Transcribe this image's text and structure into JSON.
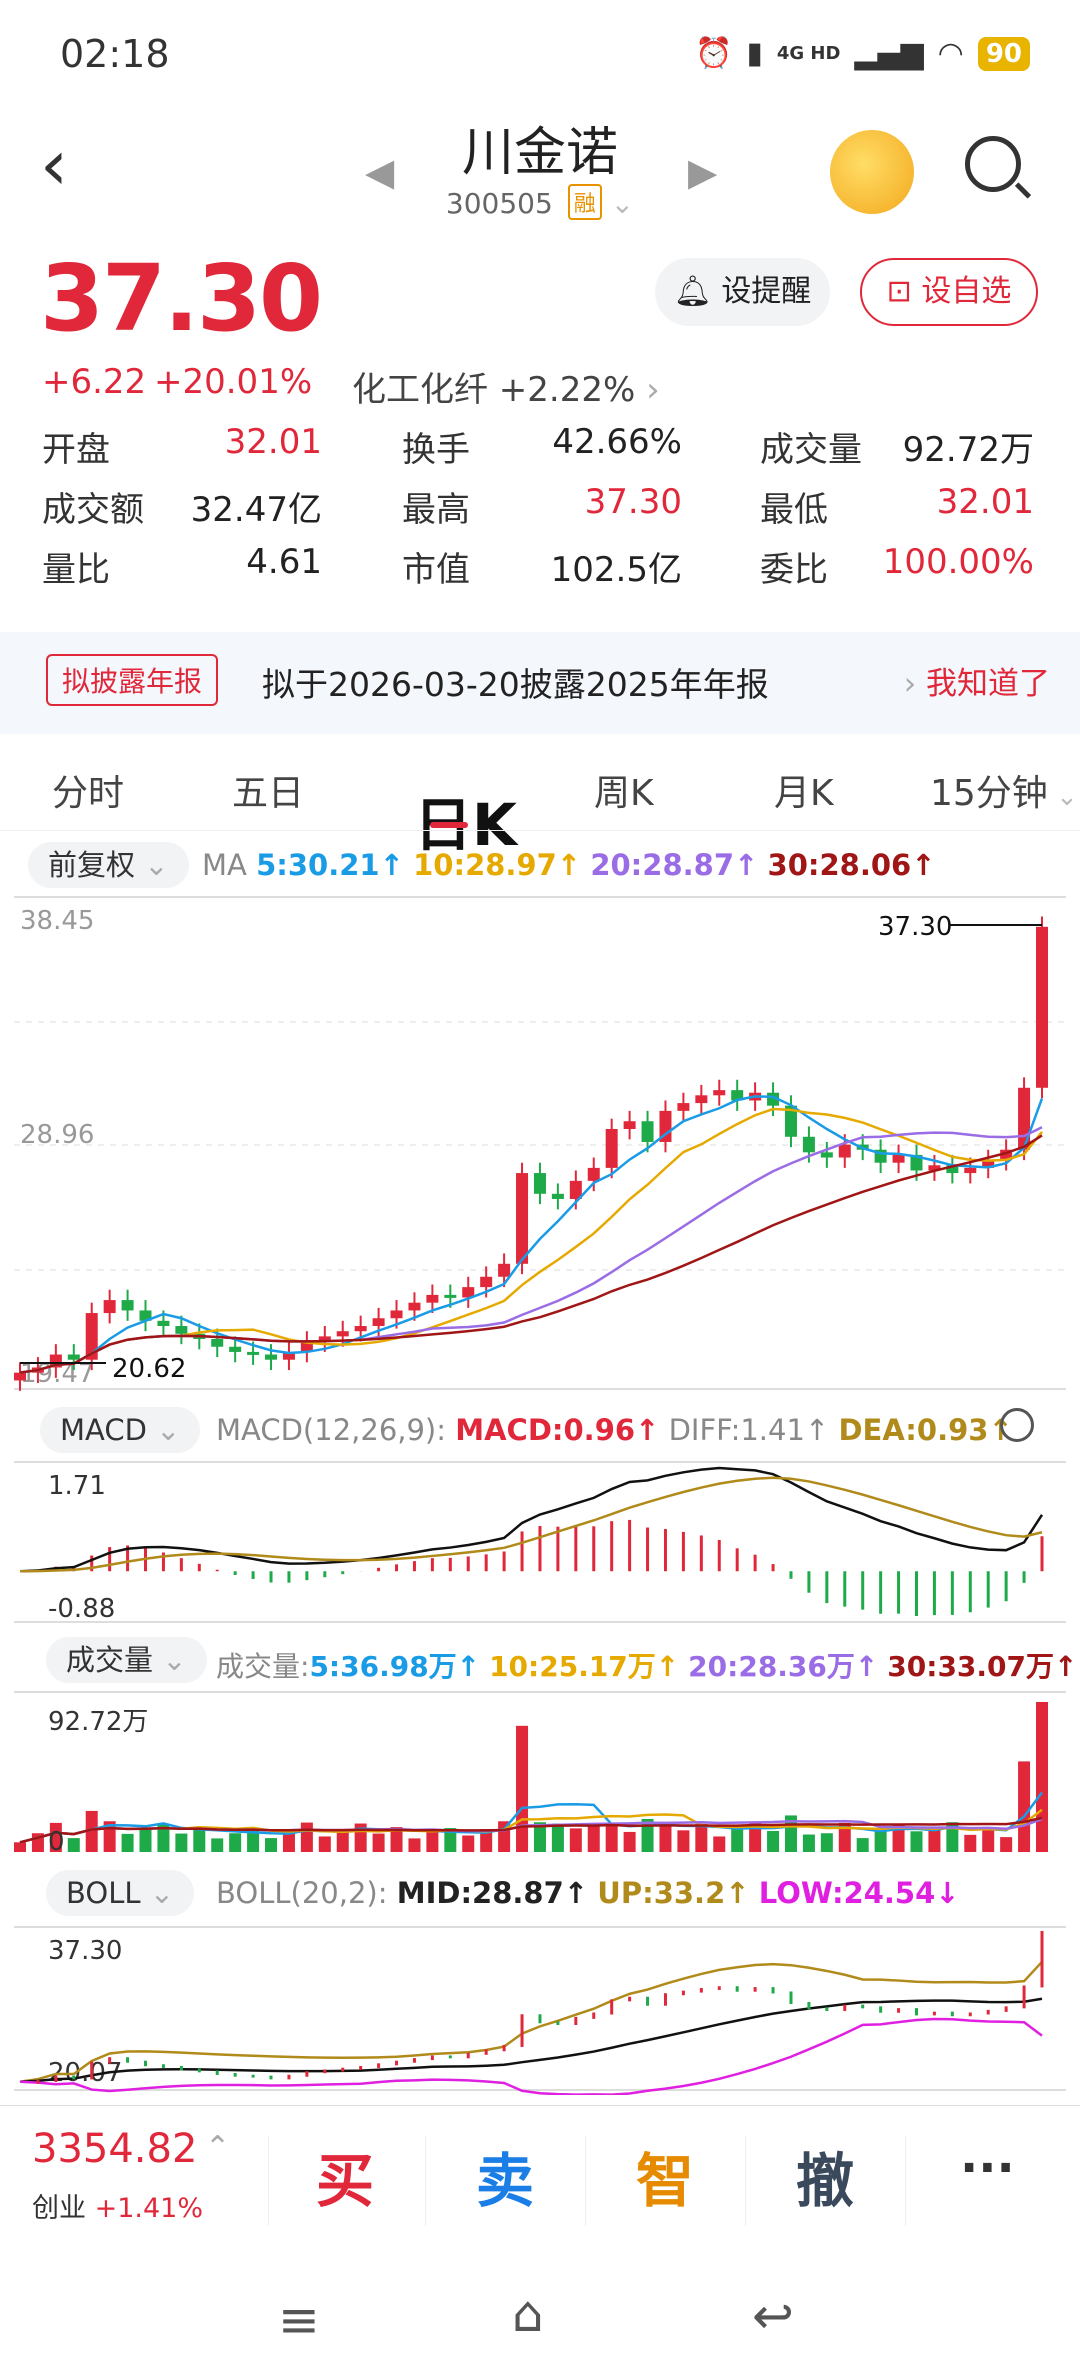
{
  "status_bar": {
    "time": "02:18",
    "network": "4G HD",
    "battery": "90"
  },
  "header": {
    "title": "川金诺",
    "code": "300505",
    "tag": "融"
  },
  "quote": {
    "price": "37.30",
    "change": "+6.22",
    "change_pct": "+20.01%",
    "sector": "化工化纤 +2.22%",
    "alert_button": "设提醒",
    "watch_button": "设自选",
    "stats": [
      {
        "label": "开盘",
        "value": "32.01",
        "color": "#e0283a"
      },
      {
        "label": "换手",
        "value": "42.66%",
        "color": "#222"
      },
      {
        "label": "成交量",
        "value": "92.72万",
        "color": "#222"
      },
      {
        "label": "成交额",
        "value": "32.47亿",
        "color": "#222"
      },
      {
        "label": "最高",
        "value": "37.30",
        "color": "#e0283a"
      },
      {
        "label": "最低",
        "value": "32.01",
        "color": "#e0283a"
      },
      {
        "label": "量比",
        "value": "4.61",
        "color": "#222"
      },
      {
        "label": "市值",
        "value": "102.5亿",
        "color": "#222"
      },
      {
        "label": "委比",
        "value": "100.00%",
        "color": "#e0283a"
      }
    ]
  },
  "banner": {
    "tag": "拟披露年报",
    "text": "拟于2026-03-20披露2025年年报",
    "action": "我知道了"
  },
  "tabs": [
    "分时",
    "五日",
    "日K",
    "周K",
    "月K",
    "15分钟"
  ],
  "kline": {
    "adjust": "前复权",
    "ma_label": "MA",
    "ma": [
      {
        "text": "5:30.21↑",
        "color": "#1a9be6"
      },
      {
        "text": "10:28.97↑",
        "color": "#e6a900"
      },
      {
        "text": "20:28.87↑",
        "color": "#9a6ce6"
      },
      {
        "text": "30:28.06↑",
        "color": "#a01515"
      }
    ],
    "y_top": "38.45",
    "y_mid": "28.96",
    "y_bottom": "19.47",
    "high_label": "37.30",
    "low_label": "20.62"
  },
  "macd": {
    "name": "MACD",
    "params": "MACD(12,26,9):",
    "macd": "MACD:0.96↑",
    "diff": "DIFF:1.41↑",
    "dea": "DEA:0.93↑",
    "y_top": "1.71",
    "y_bottom": "-0.88"
  },
  "volume": {
    "name": "成交量",
    "label": "成交量:",
    "ma": [
      {
        "text": "5:36.98万↑",
        "color": "#1a9be6"
      },
      {
        "text": "10:25.17万↑",
        "color": "#e6a900"
      },
      {
        "text": "20:28.36万↑",
        "color": "#9a6ce6"
      },
      {
        "text": "30:33.07万↑",
        "color": "#a01515"
      }
    ],
    "y_top": "92.72万",
    "y_bottom": "0"
  },
  "boll": {
    "name": "BOLL",
    "params": "BOLL(20,2):",
    "mid": "MID:28.87↑",
    "up": "UP:33.2↑",
    "low": "LOW:24.54↓",
    "y_top": "37.30",
    "y_bottom": "20.07"
  },
  "bottom": {
    "index_value": "3354.82",
    "index_name": "创业",
    "index_change": "+1.41%",
    "actions": [
      {
        "label": "买",
        "color": "#e0283a"
      },
      {
        "label": "卖",
        "color": "#1a7ee6"
      },
      {
        "label": "智",
        "color": "#e68a00"
      },
      {
        "label": "撤",
        "color": "#3a4a5c"
      }
    ],
    "more": "···"
  },
  "chart_data": {
    "type": "candlestick",
    "title": "",
    "y_range": [
      19.47,
      38.45
    ],
    "close_approx": [
      20.1,
      20.3,
      20.8,
      20.6,
      22.4,
      22.9,
      22.5,
      22.1,
      21.9,
      21.6,
      21.4,
      21.1,
      20.9,
      20.8,
      20.6,
      20.9,
      21.3,
      21.5,
      21.7,
      21.9,
      22.2,
      22.5,
      22.8,
      23.1,
      23.0,
      23.4,
      23.8,
      24.3,
      27.8,
      27.0,
      26.8,
      27.5,
      28.0,
      29.5,
      29.8,
      29.0,
      30.2,
      30.5,
      30.8,
      31.0,
      30.6,
      30.9,
      30.4,
      29.2,
      28.6,
      28.4,
      28.9,
      28.7,
      28.2,
      28.5,
      27.9,
      28.1,
      27.8,
      28.0,
      28.3,
      28.7,
      31.09,
      37.3
    ]
  }
}
